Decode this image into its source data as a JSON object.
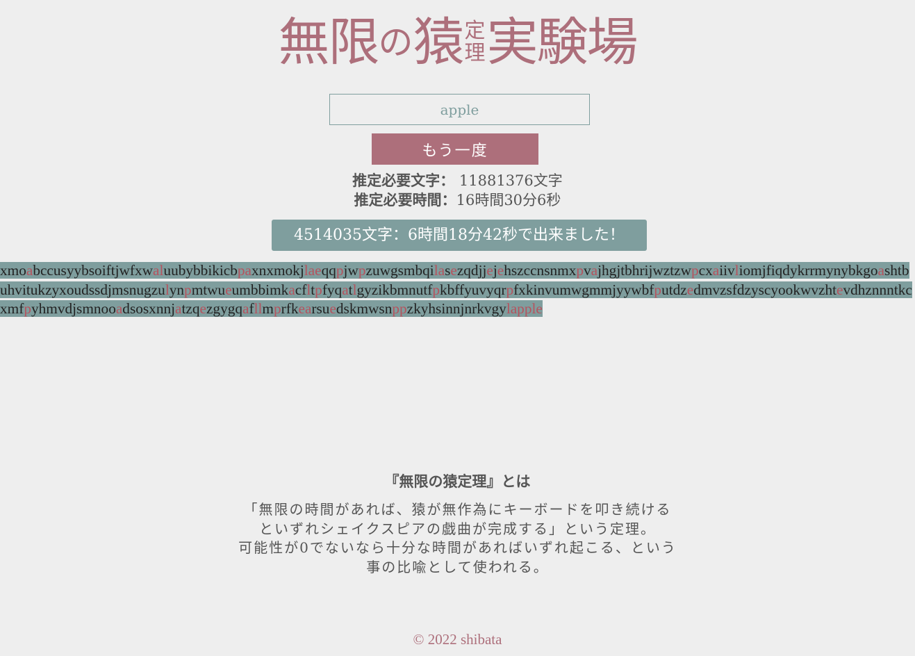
{
  "logo": {
    "part1": "無限",
    "part2": "の",
    "part3": "猿",
    "stack_top": "定",
    "stack_bottom": "理",
    "part4": "実験場"
  },
  "input": {
    "value": "apple",
    "placeholder": "apple"
  },
  "retry_button": "もう一度",
  "estimates": {
    "chars_label": "推定必要文字：",
    "chars_value": "11881376文字",
    "time_label": "推定必要時間：",
    "time_value": "16時間30分6秒"
  },
  "result": "4514035文字：6時間18分42秒で出来ました！",
  "typed_text": [
    {
      "t": "xmo"
    },
    {
      "t": "a",
      "r": true
    },
    {
      "t": "bccusyybsoiftjwfxw"
    },
    {
      "t": "al",
      "r": true
    },
    {
      "t": "uubybbikicb"
    },
    {
      "t": "pa",
      "r": true
    },
    {
      "t": "xnxmokj"
    },
    {
      "t": "lae",
      "r": true
    },
    {
      "t": "qq"
    },
    {
      "t": "p",
      "r": true
    },
    {
      "t": "jw"
    },
    {
      "t": "p",
      "r": true
    },
    {
      "t": "zuwgsmbqi"
    },
    {
      "t": "la",
      "r": true
    },
    {
      "t": "s"
    },
    {
      "t": "e",
      "r": true
    },
    {
      "t": "zqdjj"
    },
    {
      "t": "e",
      "r": true
    },
    {
      "t": "j"
    },
    {
      "t": "e",
      "r": true
    },
    {
      "t": "hszccnsnmx"
    },
    {
      "t": "p",
      "r": true
    },
    {
      "t": "v"
    },
    {
      "t": "a",
      "r": true
    },
    {
      "t": "jhgjtbhrijwztzw"
    },
    {
      "t": "p",
      "r": true
    },
    {
      "t": "cx"
    },
    {
      "t": "a",
      "r": true
    },
    {
      "t": "iiv"
    },
    {
      "t": "l",
      "r": true
    },
    {
      "t": "iomjfiqdyk"
    },
    {
      "t": "rrmynybkgo"
    },
    {
      "t": "a",
      "r": true
    },
    {
      "t": "shtbuhvitukzyxoudssdjmsnugzu"
    },
    {
      "t": "l",
      "r": true
    },
    {
      "t": "yn"
    },
    {
      "t": "p",
      "r": true
    },
    {
      "t": "mtwu"
    },
    {
      "t": "e",
      "r": true
    },
    {
      "t": "umbbimk"
    },
    {
      "t": "a",
      "r": true
    },
    {
      "t": "cf"
    },
    {
      "t": "l",
      "r": true
    },
    {
      "t": "t"
    },
    {
      "t": "p",
      "r": true
    },
    {
      "t": "fyq"
    },
    {
      "t": "a",
      "r": true
    },
    {
      "t": "t"
    },
    {
      "t": "l",
      "r": true
    },
    {
      "t": "gyzikbmnutf"
    },
    {
      "t": "p",
      "r": true
    },
    {
      "t": "kbffyuvyqr"
    },
    {
      "t": "p",
      "r": true
    },
    {
      "t": "fxkinvumwgmmjyywbf"
    },
    {
      "t": "p",
      "r": true
    },
    {
      "t": "utdz"
    },
    {
      "t": "e",
      "r": true
    },
    {
      "t": "d"
    },
    {
      "t": "mvzsfdzyscyookwvzht"
    },
    {
      "t": "e",
      "r": true
    },
    {
      "t": "vdhznnntkcxmf"
    },
    {
      "t": "p",
      "r": true
    },
    {
      "t": "yhmvdjsmnoo"
    },
    {
      "t": "a",
      "r": true
    },
    {
      "t": "dsosxnnj"
    },
    {
      "t": "a",
      "r": true
    },
    {
      "t": "tzq"
    },
    {
      "t": "e",
      "r": true
    },
    {
      "t": "zgygq"
    },
    {
      "t": "a",
      "r": true
    },
    {
      "t": "f"
    },
    {
      "t": "ll",
      "r": true
    },
    {
      "t": "m"
    },
    {
      "t": "p",
      "r": true
    },
    {
      "t": "rfk"
    },
    {
      "t": "ea",
      "r": true
    },
    {
      "t": "rsu"
    },
    {
      "t": "e",
      "r": true
    },
    {
      "t": "dskmwsn"
    },
    {
      "t": "pp",
      "r": true
    },
    {
      "t": "zkyhsinnjnrkvgy"
    },
    {
      "t": "lapple",
      "r": true
    }
  ],
  "about": {
    "title": "『無限の猿定理』とは",
    "line1": "「無限の時間があれば、猿が無作為にキーボードを叩き続ける",
    "line2": "といずれシェイクスピアの戯曲が完成する」という定理。",
    "line3": "可能性が0でないなら十分な時間があればいずれ起こる、という",
    "line4": "事の比喩として使われる。"
  },
  "footer": "© 2022 shibata",
  "colors": {
    "accent": "#ad6f7b",
    "teal": "#7f9e9e",
    "background": "#eeeeee",
    "match_red": "#b5535e"
  }
}
